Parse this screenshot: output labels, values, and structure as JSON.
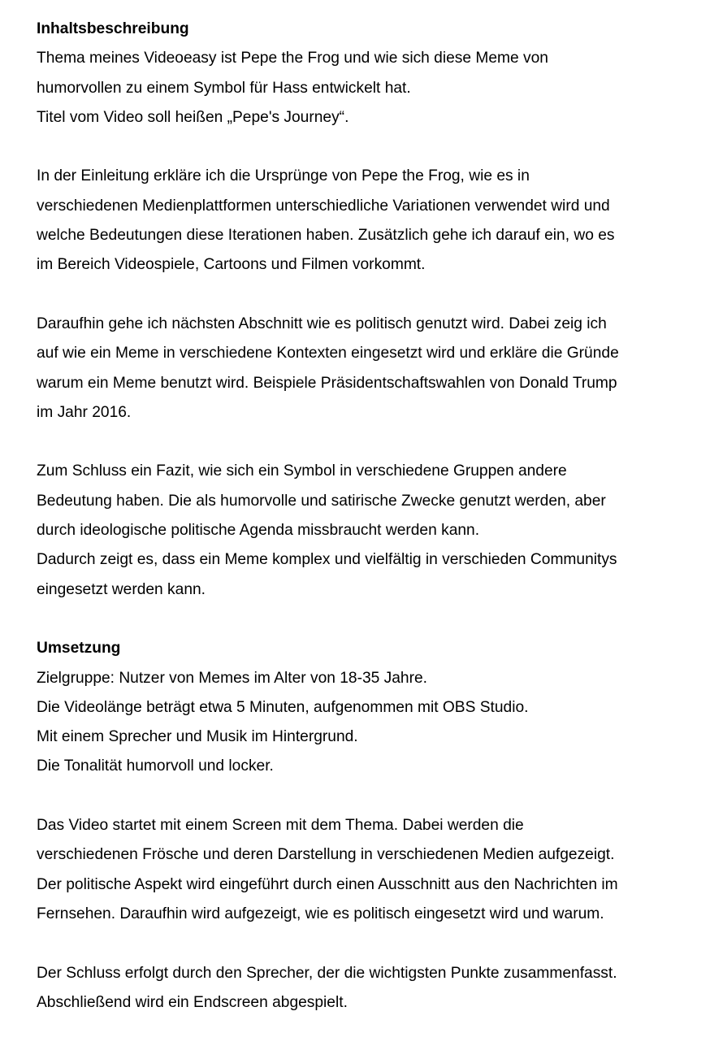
{
  "sections": [
    {
      "heading": "Inhaltsbeschreibung",
      "paragraphs": [
        [
          "Thema meines Videoeasy ist Pepe the Frog und wie sich diese Meme von",
          "humorvollen zu einem Symbol für Hass entwickelt hat.",
          "Titel vom Video soll heißen „Pepe's Journey“."
        ],
        [
          "In der Einleitung erkläre ich die Ursprünge von Pepe the Frog, wie es in",
          "verschiedenen Medienplattformen unterschiedliche Variationen verwendet wird und",
          "welche Bedeutungen diese Iterationen haben. Zusätzlich gehe ich darauf ein, wo es",
          "im Bereich Videospiele, Cartoons und Filmen vorkommt."
        ],
        [
          "Daraufhin gehe ich nächsten Abschnitt wie es politisch genutzt wird. Dabei zeig ich",
          "auf wie ein Meme in verschiedene Kontexten eingesetzt wird und erkläre die Gründe",
          "warum ein Meme benutzt wird. Beispiele Präsidentschaftswahlen von Donald Trump",
          "im Jahr 2016."
        ],
        [
          "Zum Schluss ein Fazit, wie sich ein Symbol in verschiedene Gruppen andere",
          "Bedeutung haben. Die als humorvolle und satirische Zwecke genutzt werden, aber",
          "durch ideologische politische Agenda missbraucht werden kann.",
          "Dadurch zeigt es, dass ein Meme komplex und vielfältig in verschieden Communitys",
          "eingesetzt werden kann."
        ]
      ]
    },
    {
      "heading": "Umsetzung",
      "paragraphs": [
        [
          "Zielgruppe: Nutzer von Memes im Alter von 18-35 Jahre.",
          "Die Videolänge beträgt etwa 5 Minuten, aufgenommen mit OBS Studio.",
          "Mit einem Sprecher und Musik im Hintergrund.",
          "Die Tonalität humorvoll und locker."
        ],
        [
          "Das Video startet mit einem Screen mit dem Thema. Dabei werden die",
          "verschiedenen Frösche und deren Darstellung in verschiedenen Medien aufgezeigt.",
          "Der politische Aspekt wird eingeführt durch einen Ausschnitt aus den Nachrichten im",
          "Fernsehen. Daraufhin wird aufgezeigt, wie es politisch eingesetzt wird und warum."
        ],
        [
          "Der Schluss erfolgt durch den Sprecher, der die wichtigsten Punkte zusammenfasst.",
          "Abschließend wird ein Endscreen abgespielt."
        ]
      ]
    }
  ]
}
